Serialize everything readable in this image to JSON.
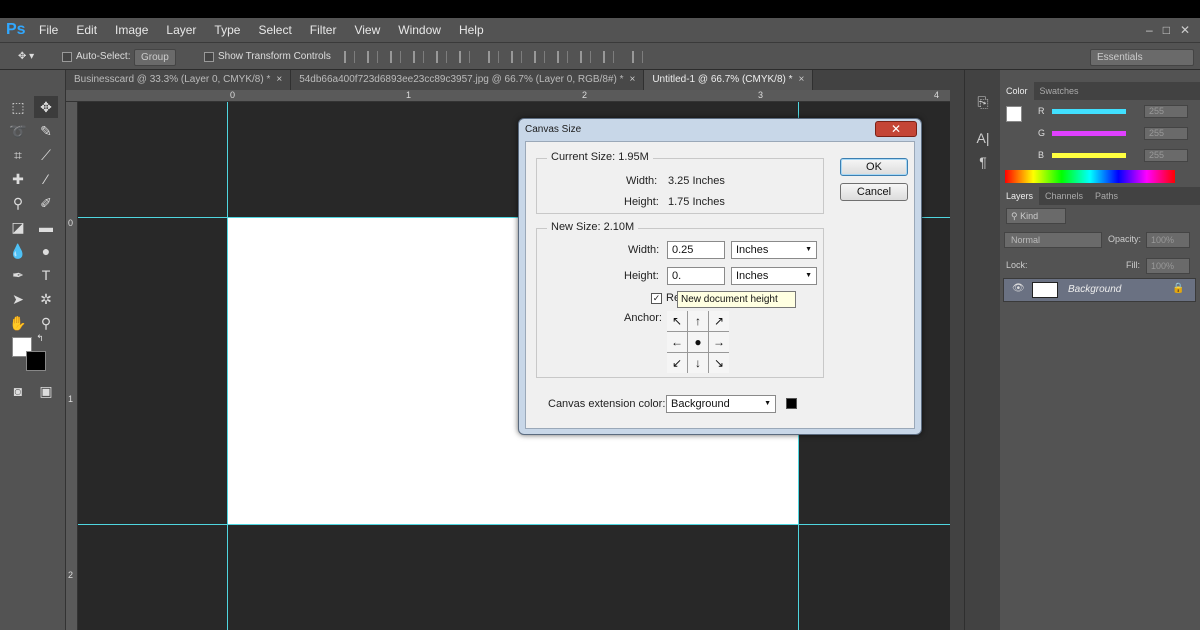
{
  "app": {
    "logo": "Ps"
  },
  "menu": [
    "File",
    "Edit",
    "Image",
    "Layer",
    "Type",
    "Select",
    "Filter",
    "View",
    "Window",
    "Help"
  ],
  "window_controls": {
    "minimize": "–",
    "restore": "□",
    "close": "✕"
  },
  "options_bar": {
    "auto_select_label": "Auto-Select:",
    "auto_select_value": "Group",
    "transform_label": "Show Transform Controls",
    "workspace": "Essentials"
  },
  "doc_tabs": [
    {
      "label": "Businesscard @ 33.3% (Layer 0, CMYK/8) *",
      "close": "×"
    },
    {
      "label": "54db66a400f723d6893ee23cc89c3957.jpg @ 66.7% (Layer 0, RGB/8#) *",
      "close": "×"
    },
    {
      "label": "Untitled-1 @ 66.7% (CMYK/8) *",
      "close": "×"
    }
  ],
  "ruler": {
    "h_marks": [
      "0",
      "1",
      "2",
      "3",
      "4"
    ],
    "v_marks": [
      "0",
      "1",
      "2"
    ]
  },
  "dialog": {
    "title": "Canvas Size",
    "close": "✕",
    "current_size_label": "Current Size: 1.95M",
    "current_width_label": "Width:",
    "current_width_value": "3.25 Inches",
    "current_height_label": "Height:",
    "current_height_value": "1.75 Inches",
    "new_size_label": "New Size: 2.10M",
    "width_label": "Width:",
    "width_value": "0.25",
    "width_unit": "Inches",
    "height_label": "Height:",
    "height_value": "0.",
    "height_unit": "Inches",
    "relative_label": "Re",
    "anchor_label": "Anchor:",
    "anchor_cells": [
      "↖",
      "↑",
      "↗",
      "←",
      "●",
      "→",
      "↙",
      "↓",
      "↘"
    ],
    "extension_label": "Canvas extension color:",
    "extension_value": "Background",
    "ok": "OK",
    "cancel": "Cancel",
    "tooltip": "New document height"
  },
  "color_panel": {
    "tabs": [
      "Color",
      "Swatches"
    ],
    "channels": [
      {
        "label": "R",
        "value": "255",
        "color": "#41e0ff"
      },
      {
        "label": "G",
        "value": "255",
        "color": "#e040ff"
      },
      {
        "label": "B",
        "value": "255",
        "color": "#ffff40"
      }
    ]
  },
  "layers_panel": {
    "tabs": [
      "Layers",
      "Channels",
      "Paths"
    ],
    "kind": "Kind",
    "blend_mode": "Normal",
    "opacity_label": "Opacity:",
    "opacity_value": "100%",
    "lock_label": "Lock:",
    "fill_label": "Fill:",
    "fill_value": "100%",
    "layer_name": "Background"
  },
  "colors": {
    "guide": "#4fd6e0",
    "accent": "#31a8ff"
  }
}
